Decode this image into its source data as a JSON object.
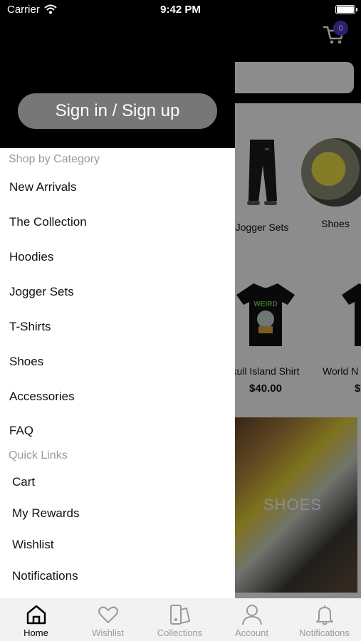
{
  "status_bar": {
    "carrier": "Carrier",
    "time": "9:42 PM"
  },
  "cart": {
    "badge_count": "0"
  },
  "categories_strip": [
    {
      "label": "Jogger Sets"
    },
    {
      "label": "Shoes"
    }
  ],
  "products": [
    {
      "name": "kull Island Shirt",
      "price": "$40.00"
    },
    {
      "name": "World N",
      "price": "$"
    }
  ],
  "banner": {
    "label": "SHOES"
  },
  "drawer": {
    "signin_label": "Sign in / Sign up",
    "shop_by_category_title": "Shop by Category",
    "categories": [
      {
        "label": "New Arrivals"
      },
      {
        "label": "The Collection"
      },
      {
        "label": "Hoodies"
      },
      {
        "label": "Jogger Sets"
      },
      {
        "label": "T-Shirts"
      },
      {
        "label": "Shoes"
      },
      {
        "label": "Accessories"
      },
      {
        "label": "FAQ"
      }
    ],
    "quick_links_title": "Quick Links",
    "quick_links": [
      {
        "label": "Cart"
      },
      {
        "label": "My Rewards"
      },
      {
        "label": "Wishlist"
      },
      {
        "label": "Notifications"
      }
    ]
  },
  "tabbar": {
    "tabs": [
      {
        "label": "Home",
        "icon": "home-icon",
        "active": true
      },
      {
        "label": "Wishlist",
        "icon": "heart-icon",
        "active": false
      },
      {
        "label": "Collections",
        "icon": "collections-icon",
        "active": false
      },
      {
        "label": "Account",
        "icon": "account-icon",
        "active": false
      },
      {
        "label": "Notifications",
        "icon": "bell-icon",
        "active": false
      }
    ]
  },
  "colors": {
    "badge": "#4b3bc9",
    "signin_button": "#777777",
    "drawer_header": "#000000"
  }
}
